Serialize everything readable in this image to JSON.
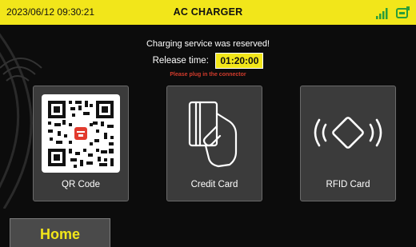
{
  "statusbar": {
    "datetime": "2023/06/12 09:30:21",
    "title": "AC CHARGER",
    "signal_icon": "signal-bars-icon",
    "plug_icon": "charger-plug-icon"
  },
  "messages": {
    "reserved": "Charging service was reserved!",
    "release_label": "Release time:",
    "release_time": "01:20:00",
    "warning": "Please plug in the connector"
  },
  "options": [
    {
      "label": "QR Code",
      "icon": "qr-code-icon"
    },
    {
      "label": "Credit Card",
      "icon": "credit-card-icon"
    },
    {
      "label": "RFID Card",
      "icon": "rfid-icon"
    }
  ],
  "nav": {
    "home_label": "Home"
  },
  "colors": {
    "accent": "#f2e61a",
    "background": "#0c0c0c",
    "card": "#3b3b3b",
    "warning": "#d23b2c"
  }
}
